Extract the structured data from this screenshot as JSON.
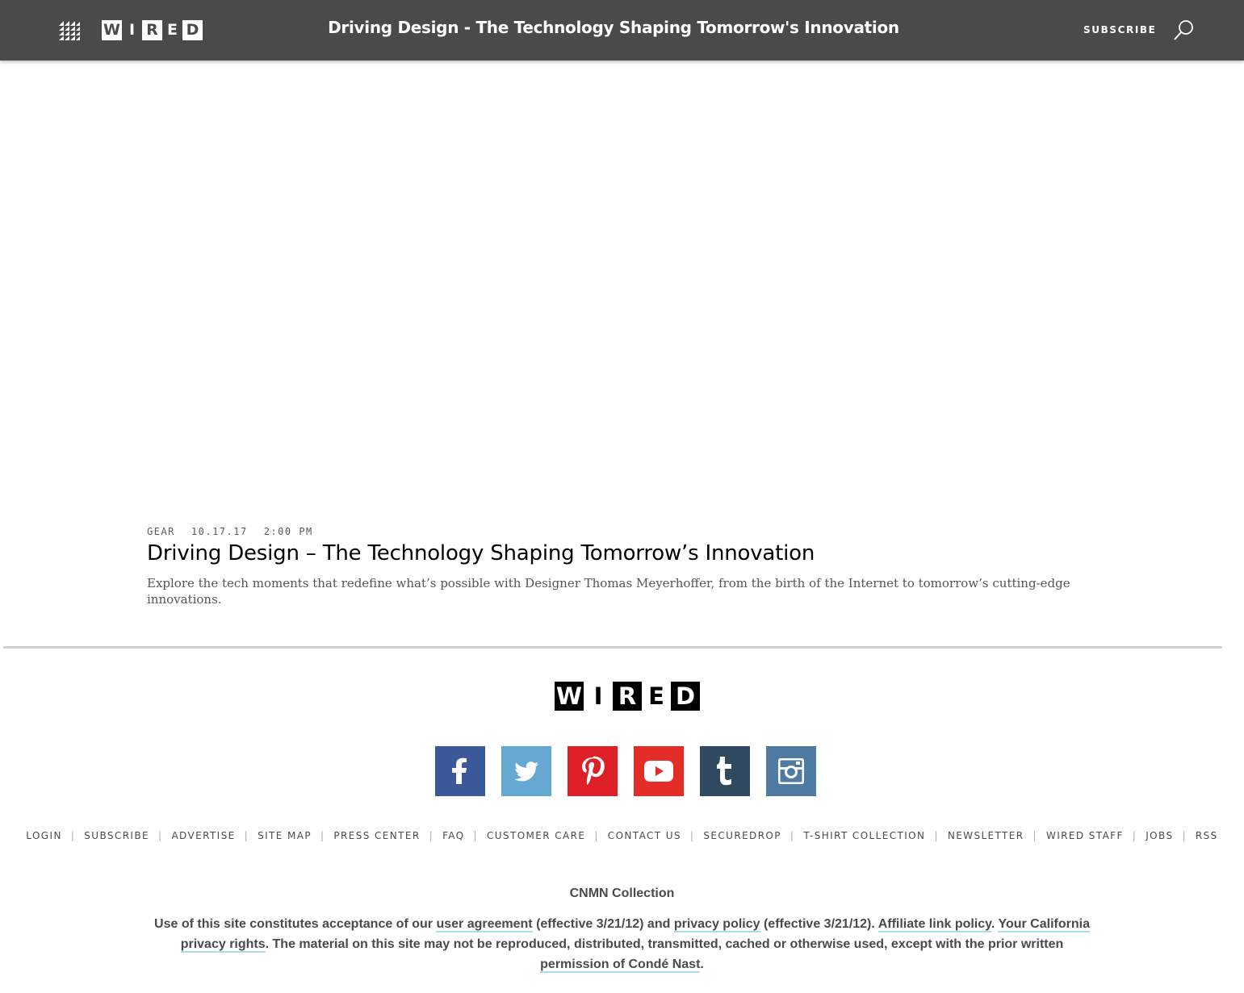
{
  "header": {
    "logo_letters": [
      "W",
      "I",
      "R",
      "E",
      "D"
    ],
    "title": "Driving Design - The Technology Shaping Tomorrow's Innovation",
    "subscribe_label": "SUBSCRIBE"
  },
  "article": {
    "category": "GEAR",
    "date": "10.17.17",
    "time": "2:00 PM",
    "title": "Driving Design – The Technology Shaping Tomorrow’s Innovation",
    "dek": "Explore the tech moments that redefine what’s possible with Designer Thomas Meyerhoffer, from the birth of the Internet to tomorrow’s cutting-edge innovations."
  },
  "footer": {
    "logo_letters": [
      "W",
      "I",
      "R",
      "E",
      "D"
    ],
    "socials": [
      {
        "name": "facebook",
        "icon": "facebook-icon",
        "color": "#3b5998"
      },
      {
        "name": "twitter",
        "icon": "twitter-icon",
        "color": "#65a8d1"
      },
      {
        "name": "pinterest",
        "icon": "pinterest-icon",
        "color": "#df1f28"
      },
      {
        "name": "youtube",
        "icon": "youtube-icon",
        "color": "#e52d27"
      },
      {
        "name": "tumblr",
        "icon": "tumblr-icon",
        "color": "#2f4a60"
      },
      {
        "name": "instagram",
        "icon": "instagram-icon",
        "color": "#4f7aa2"
      }
    ],
    "nav": [
      "LOGIN",
      "SUBSCRIBE",
      "ADVERTISE",
      "SITE MAP",
      "PRESS CENTER",
      "FAQ",
      "CUSTOMER CARE",
      "CONTACT US",
      "SECUREDROP",
      "T-SHIRT COLLECTION",
      "NEWSLETTER",
      "WIRED STAFF",
      "JOBS",
      "RSS"
    ],
    "collection": "CNMN Collection",
    "legal": {
      "t1": "Use of this site constitutes acceptance of our ",
      "link_user_agreement": "user agreement",
      "t2": " (effective 3/21/12) and ",
      "link_privacy_policy": "privacy policy",
      "t3": " (effective 3/21/12). ",
      "link_affiliate": "Affiliate link policy",
      "t4": ". ",
      "link_california": "Your California privacy rights",
      "t5": ". The material on this site may not be reproduced, distributed, transmitted, cached or otherwise used, except with the prior written ",
      "link_permission": "permission of Condé Nast",
      "t6": "."
    }
  }
}
